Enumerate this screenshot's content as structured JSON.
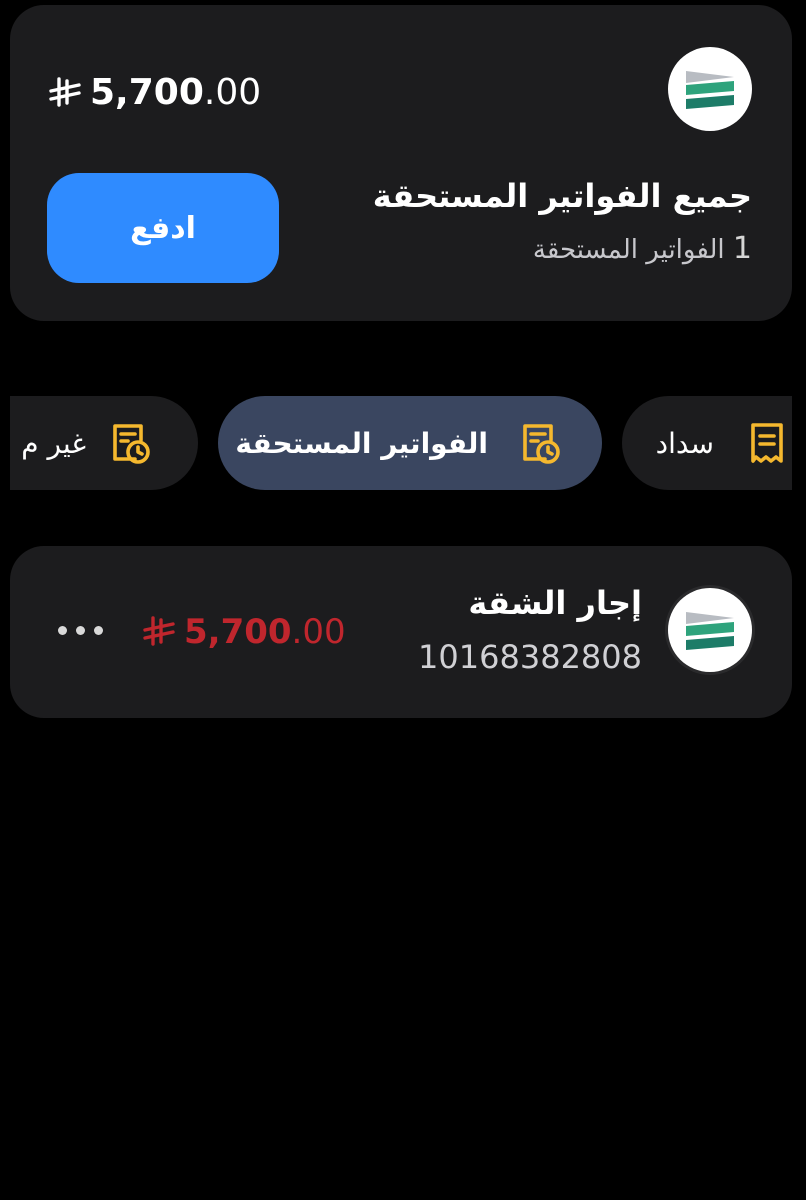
{
  "colors": {
    "background": "#000000",
    "card": "#1c1c1e",
    "pay_button": "#2f8bff",
    "active_tab": "#3a4660",
    "tab_icon": "#f5b82e",
    "due_amount": "#c0262d"
  },
  "summary": {
    "logo_icon": "biller-logo-icon",
    "currency_icon": "saudi-riyal-icon",
    "amount_integer": "5,700",
    "amount_decimal": ".00",
    "title": "جميع الفواتير المستحقة",
    "count": "1",
    "count_label": "الفواتير المستحقة",
    "pay_label": "ادفع"
  },
  "tabs": [
    {
      "label": "سداد",
      "icon": "receipt-icon",
      "active": false
    },
    {
      "label": "الفواتير المستحقة",
      "icon": "due-bill-clock-icon",
      "active": true
    },
    {
      "label": "غير م",
      "icon": "due-bill-clock-icon",
      "active": false
    }
  ],
  "bill": {
    "logo_icon": "biller-logo-icon",
    "name": "إجار الشقة",
    "number": "10168382808",
    "currency_icon": "saudi-riyal-icon",
    "amount_integer": "5,700",
    "amount_decimal": ".00",
    "more_icon": "more-dots-icon"
  }
}
